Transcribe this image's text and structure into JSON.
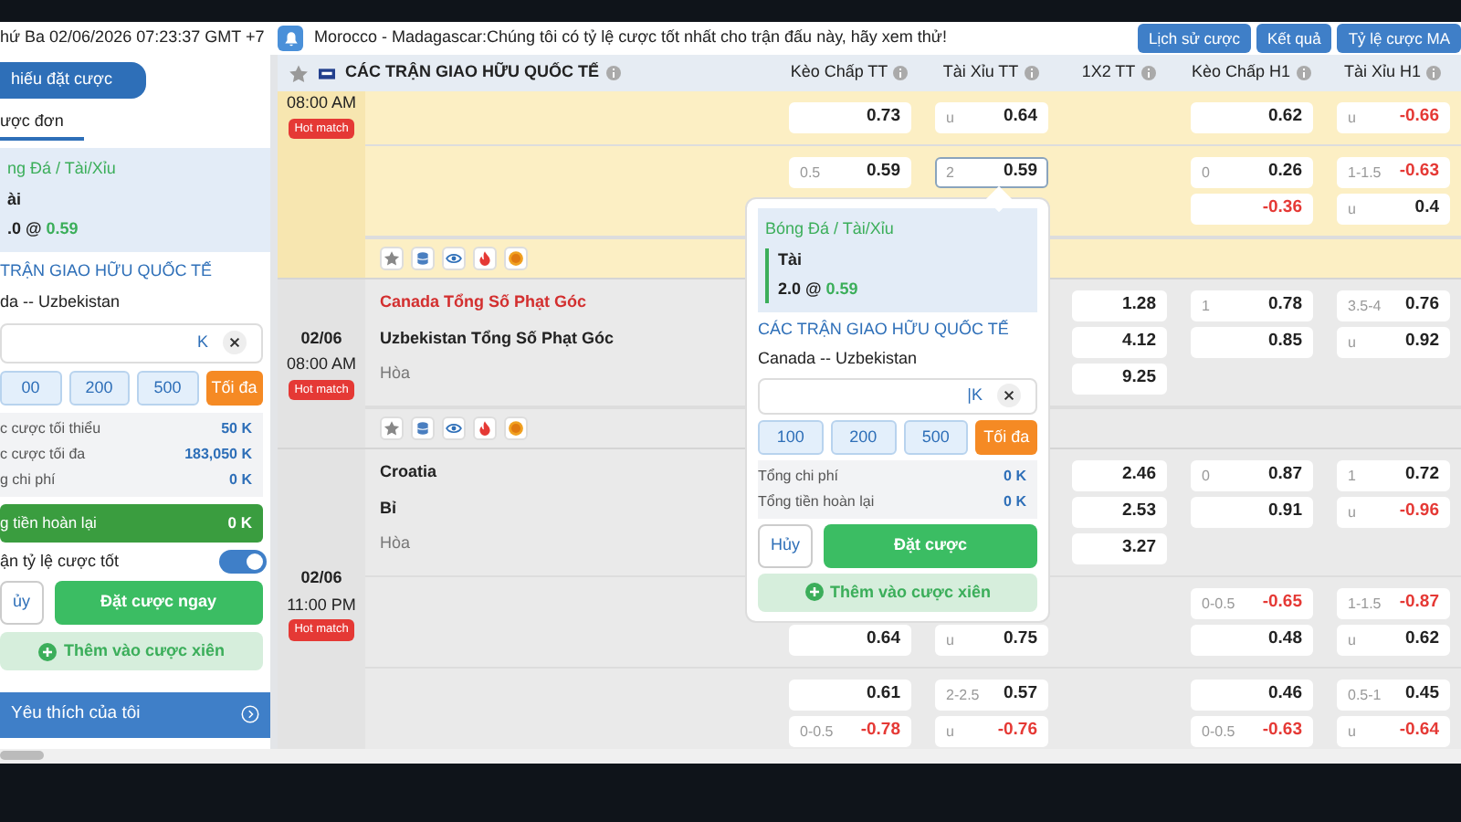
{
  "top_bar": {
    "clock": "hứ Ba 02/06/2026 07:23:37 GMT +7",
    "notice": "Morocco - Madagascar:Chúng tôi có tỷ lệ cược tốt nhất cho trận đấu này, hãy xem thử!",
    "buttons": [
      "Lịch sử cược",
      "Kết quả",
      "Tỷ lệ cược MA"
    ]
  },
  "bet_slip": {
    "header": "hiếu đặt cược",
    "mode_tabs": [
      {
        "label": "ược đơn",
        "selected": true
      }
    ],
    "sport": "ng Đá / Tài/Xỉu",
    "pick": "ài",
    "line": ".0 @",
    "price": "0.59",
    "league": "TRẬN GIAO HỮU QUỐC TẾ",
    "teams": "da  --  Uzbekistan",
    "unit": "K",
    "chips": [
      "00",
      "200",
      "500"
    ],
    "max_label": "Tối đa",
    "limits": [
      {
        "label": "c cược tối thiểu",
        "value": "50 K"
      },
      {
        "label": "c cược tối đa",
        "value": "183,050 K"
      },
      {
        "label": "g chi phí",
        "value": "0 K"
      }
    ],
    "refund": {
      "label": "g tiền hoàn lại",
      "value": "0 K"
    },
    "accept": {
      "label": "ận tỷ lệ cược tốt",
      "on": true
    },
    "cancel": "ủy",
    "place": "Đặt cược ngay",
    "add_parlay": "Thêm vào cược xiên",
    "menu": [
      "Yêu thích của tôi"
    ]
  },
  "table": {
    "league": "CÁC TRẬN GIAO HỮU QUỐC TẾ",
    "columns": [
      "Kèo Chấp TT",
      "Tài Xỉu TT",
      "1X2 TT",
      "Kèo Chấp H1",
      "Tài Xỉu H1"
    ],
    "matches": [
      {
        "highlighted": true,
        "time": "08:00 AM",
        "hot": "Hot match",
        "icon_bar": true,
        "groups": [
          {
            "odds": {
              "handicap_ft": {
                "cells": [
                  {
                    "value": "0.73",
                    "negative": false,
                    "selected": false
                  }
                ]
              },
              "over_under_ft": {
                "cells": [
                  {
                    "line": "u",
                    "value": "0.64",
                    "negative": false,
                    "selected": false
                  }
                ]
              },
              "handicap_h1": {
                "cells": [
                  {
                    "value": "0.62",
                    "negative": false,
                    "selected": false
                  }
                ]
              },
              "over_under_h1": {
                "cells": [
                  {
                    "line": "u",
                    "value": "-0.66",
                    "negative": true,
                    "selected": false
                  }
                ]
              }
            }
          },
          {
            "odds": {
              "handicap_ft": {
                "cells": [
                  {
                    "line": "0.5",
                    "value": "0.59",
                    "negative": false,
                    "selected": false
                  }
                ]
              },
              "over_under_ft": {
                "cells": [
                  {
                    "line": "2",
                    "value": "0.59",
                    "negative": false,
                    "selected": true
                  }
                ]
              },
              "handicap_h1": {
                "cells": [
                  {
                    "line": "0",
                    "value": "0.26",
                    "negative": false,
                    "selected": false
                  },
                  {
                    "value": "-0.36",
                    "negative": true,
                    "selected": false
                  }
                ]
              },
              "over_under_h1": {
                "cells": [
                  {
                    "line": "1-1.5",
                    "value": "-0.63",
                    "negative": true,
                    "selected": false
                  },
                  {
                    "line": "u",
                    "value": "0.4",
                    "negative": false,
                    "selected": false
                  }
                ]
              }
            }
          }
        ]
      },
      {
        "highlighted": false,
        "date": "02/06",
        "time": "08:00 AM",
        "hot": "Hot match",
        "icon_bar": true,
        "groups": [
          {
            "teams": [
              {
                "name": "Canada Tổng Số Phạt Góc",
                "kind": "team",
                "favorite": true
              },
              {
                "name": "Uzbekistan Tổng Số Phạt Góc",
                "kind": "team",
                "favorite": false
              },
              {
                "name": "Hòa",
                "kind": "draw",
                "favorite": false
              }
            ],
            "odds": {
              "one_x_two_ft": {
                "cells": [
                  {
                    "value": "1.28",
                    "negative": false,
                    "selected": false
                  },
                  {
                    "value": "4.12",
                    "negative": false,
                    "selected": false
                  },
                  {
                    "value": "9.25",
                    "negative": false,
                    "selected": false
                  }
                ]
              },
              "handicap_h1": {
                "cells": [
                  {
                    "line": "1",
                    "value": "0.78",
                    "negative": false,
                    "selected": false
                  },
                  {
                    "value": "0.85",
                    "negative": false,
                    "selected": false
                  }
                ]
              },
              "over_under_h1": {
                "cells": [
                  {
                    "line": "3.5-4",
                    "value": "0.76",
                    "negative": false,
                    "selected": false
                  },
                  {
                    "line": "u",
                    "value": "0.92",
                    "negative": false,
                    "selected": false
                  }
                ]
              }
            }
          }
        ]
      },
      {
        "highlighted": false,
        "date": "02/06",
        "time": "11:00 PM",
        "hot": "Hot match",
        "icon_bar": false,
        "groups": [
          {
            "teams": [
              {
                "name": "Croatia",
                "kind": "team",
                "favorite": false
              },
              {
                "name": "Bỉ",
                "kind": "team",
                "favorite": false
              },
              {
                "name": "Hòa",
                "kind": "draw",
                "favorite": false
              }
            ],
            "odds": {
              "one_x_two_ft": {
                "cells": [
                  {
                    "value": "2.46",
                    "negative": false,
                    "selected": false
                  },
                  {
                    "value": "2.53",
                    "negative": false,
                    "selected": false
                  },
                  {
                    "value": "3.27",
                    "negative": false,
                    "selected": false
                  }
                ]
              },
              "handicap_h1": {
                "cells": [
                  {
                    "line": "0",
                    "value": "0.87",
                    "negative": false,
                    "selected": false
                  },
                  {
                    "value": "0.91",
                    "negative": false,
                    "selected": false
                  }
                ]
              },
              "over_under_h1": {
                "cells": [
                  {
                    "line": "1",
                    "value": "0.72",
                    "negative": false,
                    "selected": false
                  },
                  {
                    "line": "u",
                    "value": "-0.96",
                    "negative": true,
                    "selected": false
                  }
                ]
              }
            }
          },
          {
            "odds": {
              "handicap_ft": {
                "first_slot_hidden": true,
                "cells": [
                  {
                    "value": "0.64",
                    "negative": false,
                    "selected": false
                  }
                ]
              },
              "over_under_ft": {
                "first_slot_hidden": true,
                "cells": [
                  {
                    "line": "u",
                    "value": "0.75",
                    "negative": false,
                    "selected": false
                  }
                ]
              },
              "handicap_h1": {
                "cells": [
                  {
                    "line": "0-0.5",
                    "value": "-0.65",
                    "negative": true,
                    "selected": false
                  },
                  {
                    "value": "0.48",
                    "negative": false,
                    "selected": false
                  }
                ]
              },
              "over_under_h1": {
                "cells": [
                  {
                    "line": "1-1.5",
                    "value": "-0.87",
                    "negative": true,
                    "selected": false
                  },
                  {
                    "line": "u",
                    "value": "0.62",
                    "negative": false,
                    "selected": false
                  }
                ]
              }
            }
          },
          {
            "odds": {
              "handicap_ft": {
                "cells": [
                  {
                    "value": "0.61",
                    "negative": false,
                    "selected": false
                  },
                  {
                    "line": "0-0.5",
                    "value": "-0.78",
                    "negative": true,
                    "selected": false
                  }
                ]
              },
              "over_under_ft": {
                "cells": [
                  {
                    "line": "2-2.5",
                    "value": "0.57",
                    "negative": false,
                    "selected": false
                  },
                  {
                    "line": "u",
                    "value": "-0.76",
                    "negative": true,
                    "selected": false
                  }
                ]
              },
              "handicap_h1": {
                "cells": [
                  {
                    "value": "0.46",
                    "negative": false,
                    "selected": false
                  },
                  {
                    "line": "0-0.5",
                    "value": "-0.63",
                    "negative": true,
                    "selected": false
                  }
                ]
              },
              "over_under_h1": {
                "cells": [
                  {
                    "line": "0.5-1",
                    "value": "0.45",
                    "negative": false,
                    "selected": false
                  },
                  {
                    "line": "u",
                    "value": "-0.64",
                    "negative": true,
                    "selected": false
                  }
                ]
              }
            }
          }
        ]
      }
    ]
  },
  "popup": {
    "sport": "Bóng Đá / Tài/Xỉu",
    "pick": "Tài",
    "line": "2.0 @",
    "price": "0.59",
    "league": "CÁC TRẬN GIAO HỮU QUỐC TẾ",
    "teams": "Canada  --  Uzbekistan",
    "unit": "|K",
    "chips": [
      "100",
      "200",
      "500"
    ],
    "max_label": "Tối đa",
    "totals": [
      {
        "label": "Tổng chi phí",
        "value": "0 K"
      },
      {
        "label": "Tổng tiền hoàn lại",
        "value": "0 K"
      }
    ],
    "cancel": "Hủy",
    "place": "Đặt cược",
    "add_parlay": "Thêm vào cược xiên"
  }
}
